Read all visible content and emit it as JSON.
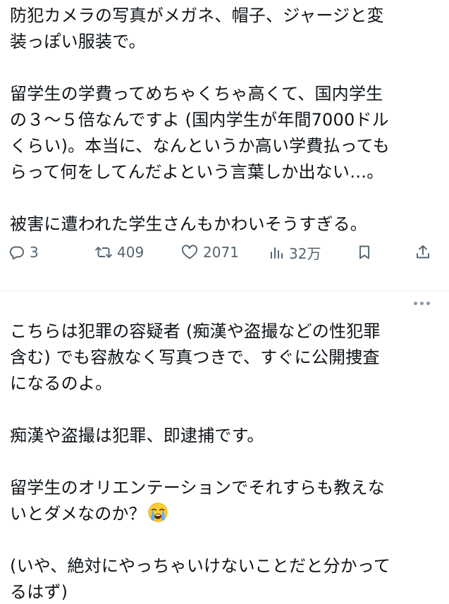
{
  "tweet1": {
    "lines": [
      "防犯カメラの写真がメガネ、帽子、ジャージと変",
      "装っぽい服装で。",
      "",
      "留学生の学費ってめちゃくちゃ高くて、国内学生",
      "の３～５倍なんですよ (国内学生が年間7000ドル",
      "くらい)。本当に、なんというか高い学費払っても",
      "らって何をしてんだよという言葉しか出ない…。",
      "",
      "被害に遭われた学生さんもかわいそうすぎる。"
    ]
  },
  "actions": {
    "reply_count": "3",
    "retweet_count": "409",
    "like_count": "2071",
    "views_count": "32万",
    "icons": [
      "reply-icon",
      "retweet-icon",
      "like-icon",
      "views-icon",
      "bookmark-icon",
      "share-icon"
    ],
    "icon_color": "#536471"
  },
  "tweet2": {
    "header_faded": "",
    "lines": [
      "こちらは犯罪の容疑者 (痴漢や盗撮などの性犯罪",
      "含む) でも容赦なく写真つきで、すぐに公開捜査",
      "になるのよ。",
      "",
      "痴漢や盗撮は犯罪、即逮捕です。",
      "",
      "留学生のオリエンテーションでそれすらも教えな",
      "いとダメなのか？",
      "",
      "(いや、絶対にやっちゃいけないことだと分かって",
      "るはず)"
    ],
    "emoji": "loudly-crying-face-emoji"
  },
  "colors": {
    "text": "#0f1419",
    "secondary": "#536471",
    "divider": "#eff3f4",
    "dots": "#8b98a5"
  }
}
